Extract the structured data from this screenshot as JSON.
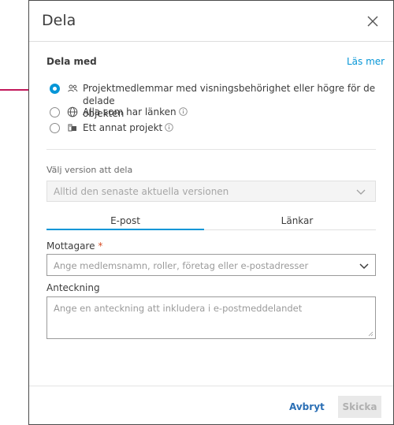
{
  "dialog": {
    "title": "Dela",
    "section_label": "Dela med",
    "read_more": "Läs mer"
  },
  "share_options": [
    {
      "label_line1": "Projektmedlemmar med visningsbehörighet eller högre för de delade",
      "label_line2": "objekten",
      "icon": "people-icon",
      "selected": true
    },
    {
      "label": "Alla som har länken",
      "icon": "globe-icon",
      "info": true,
      "selected": false
    },
    {
      "label": "Ett annat projekt",
      "icon": "folder-project-icon",
      "info": true,
      "selected": false
    }
  ],
  "version": {
    "label": "Välj version att dela",
    "value": "Alltid den senaste aktuella versionen"
  },
  "tabs": [
    {
      "label": "E-post",
      "active": true
    },
    {
      "label": "Länkar",
      "active": false
    }
  ],
  "recipients": {
    "label": "Mottagare",
    "required_mark": "*",
    "placeholder": "Ange medlemsnamn, roller, företag eller e-postadresser"
  },
  "note": {
    "label": "Anteckning",
    "placeholder": "Ange en anteckning att inkludera i e-postmeddelandet"
  },
  "footer": {
    "cancel": "Avbryt",
    "send": "Skicka"
  },
  "colors": {
    "accent": "#0696d7",
    "annotation_arrow": "#c2185b",
    "required": "#d74e26"
  }
}
